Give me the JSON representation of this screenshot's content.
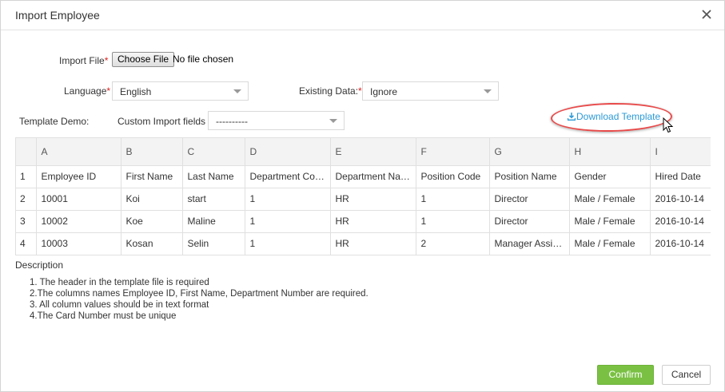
{
  "dialog": {
    "title": "Import Employee"
  },
  "form": {
    "import_file_label": "Import File",
    "choose_file_label": "Choose File",
    "file_status": "No file chosen",
    "language_label": "Language",
    "language_value": "English",
    "existing_data_label": "Existing Data:",
    "existing_data_value": "Ignore",
    "template_demo_label": "Template Demo:",
    "custom_fields_label": "Custom Import fields",
    "custom_fields_value": "----------",
    "download_label": "Download Template",
    "required_mark": "*"
  },
  "table": {
    "columns": [
      "A",
      "B",
      "C",
      "D",
      "E",
      "F",
      "G",
      "H",
      "I"
    ],
    "rows": [
      {
        "num": "1",
        "cells": [
          "Employee ID",
          "First Name",
          "Last Name",
          "Department Code",
          "Department Name",
          "Position Code",
          "Position Name",
          "Gender",
          "Hired Date"
        ]
      },
      {
        "num": "2",
        "cells": [
          "10001",
          "Koi",
          "start",
          "1",
          "HR",
          "1",
          "Director",
          "Male / Female",
          "2016-10-14"
        ]
      },
      {
        "num": "3",
        "cells": [
          "10002",
          "Koe",
          "Maline",
          "1",
          "HR",
          "1",
          "Director",
          "Male / Female",
          "2016-10-14"
        ]
      },
      {
        "num": "4",
        "cells": [
          "10003",
          "Kosan",
          "Selin",
          "1",
          "HR",
          "2",
          "Manager Assistant",
          "Male / Female",
          "2016-10-14"
        ]
      }
    ]
  },
  "description": {
    "title": "Description",
    "items": [
      "1. The header in the template file is required",
      "2.The columns names Employee ID, First Name, Department Number are required.",
      "3. All column values should be in text format",
      "4.The Card Number must be unique"
    ]
  },
  "footer": {
    "confirm_label": "Confirm",
    "cancel_label": "Cancel"
  },
  "colors": {
    "accent_link": "#2b9ad6",
    "confirm_green": "#7ac143",
    "required_red": "#e02020",
    "highlight_ring": "#e84b4b"
  },
  "icons": {
    "close": "close-icon",
    "download": "download-icon",
    "caret": "chevron-down-icon",
    "cursor": "mouse-pointer-icon"
  }
}
